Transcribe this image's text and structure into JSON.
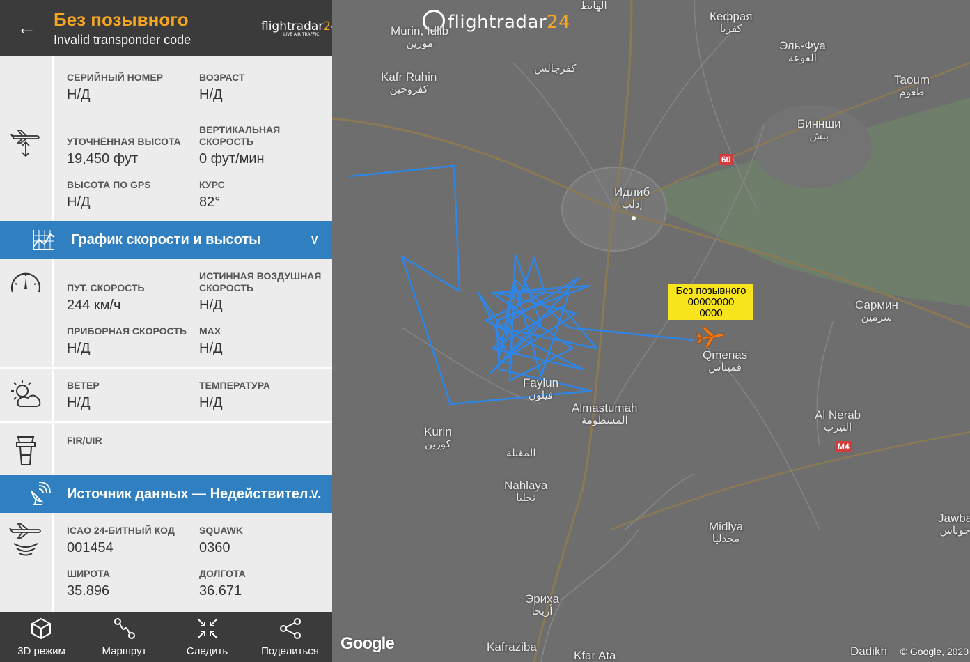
{
  "header": {
    "title": "Без позывного",
    "subtitle": "Invalid transponder code",
    "brand_main": "flightradar",
    "brand_num": "24",
    "brand_tag": "LIVE AIR TRAFFIC"
  },
  "aircraft": {
    "serial_label": "Серийный номер",
    "serial_value": "Н/Д",
    "age_label": "Возраст",
    "age_value": "Н/Д",
    "cal_alt_label": "Уточнённая высота",
    "cal_alt_value": "19,450 фут",
    "vs_label": "Вертикальная скорость",
    "vs_value": "0 фут/мин",
    "gps_alt_label": "Высота по GPS",
    "gps_alt_value": "Н/Д",
    "track_label": "Курс",
    "track_value": "82°"
  },
  "speed_band": {
    "title": "График скорости и высоты"
  },
  "speed": {
    "gs_label": "Пут. скорость",
    "gs_value": "244 км/ч",
    "tas_label": "Истинная воздушная скорость",
    "tas_value": "Н/Д",
    "ias_label": "Приборная скорость",
    "ias_value": "Н/Д",
    "mach_label": "MAX",
    "mach_value": "Н/Д"
  },
  "weather": {
    "wind_label": "Ветер",
    "wind_value": "Н/Д",
    "temp_label": "Температура",
    "temp_value": "Н/Д"
  },
  "fir": {
    "label": "FIR/UIR"
  },
  "source_band": {
    "title": "Источник данных — Недействител…"
  },
  "source": {
    "icao_label": "ICAO 24-битный код",
    "icao_value": "001454",
    "squawk_label": "Squawk",
    "squawk_value": "0360",
    "lat_label": "Широта",
    "lat_value": "35.896",
    "lon_label": "Долгота",
    "lon_value": "36.671"
  },
  "bottom_bar": {
    "mode3d": "3D режим",
    "route": "Маршрут",
    "follow": "Следить",
    "share": "Поделиться"
  },
  "map": {
    "logo_main": "flightradar",
    "logo_num": "24",
    "flight_label": {
      "line1": "Без позывного",
      "line2": "00000000",
      "line3": "0000"
    },
    "places": [
      {
        "name": "Murin, Idlib",
        "ar": "مورين"
      },
      {
        "name": "Kafr Ruhin",
        "ar": "كفروحين"
      },
      {
        "name": "",
        "ar": "كفرجالس"
      },
      {
        "name": "Кефрая",
        "ar": "كفريا"
      },
      {
        "name": "Эль-Фуа",
        "ar": "الفوعة"
      },
      {
        "name": "Taoum",
        "ar": "طعوم"
      },
      {
        "name": "Биннши",
        "ar": "بنش"
      },
      {
        "name": "Идлиб",
        "ar": "إدلب"
      },
      {
        "name": "Сармин",
        "ar": "سرمين"
      },
      {
        "name": "Qmenas",
        "ar": "قميناس"
      },
      {
        "name": "Faylun",
        "ar": "فيلون"
      },
      {
        "name": "Almastumah",
        "ar": "المسطومة"
      },
      {
        "name": "Kurin",
        "ar": "كورين"
      },
      {
        "name": "",
        "ar": "المقبلة"
      },
      {
        "name": "Al Nerab",
        "ar": "النيرب"
      },
      {
        "name": "Nahlaya",
        "ar": "نحليا"
      },
      {
        "name": "Midlya",
        "ar": "مجدليا"
      },
      {
        "name": "Jawba",
        "ar": "جوباس"
      },
      {
        "name": "Эриха",
        "ar": "أريحا"
      },
      {
        "name": "Kafraziba",
        "ar": ""
      },
      {
        "name": "Kfar Ata",
        "ar": ""
      },
      {
        "name": "Dadikh",
        "ar": ""
      },
      {
        "name": "",
        "ar": "الهابط"
      }
    ],
    "road_60": "60",
    "road_m4": "M4",
    "google": "Google",
    "copyright": "© Google, 2020"
  },
  "colors": {
    "accent": "#f5a623",
    "band": "#2f7fc1",
    "track": "#2d86e8",
    "label_bg": "#f8e41d",
    "topbar": "#3b3b3b"
  }
}
